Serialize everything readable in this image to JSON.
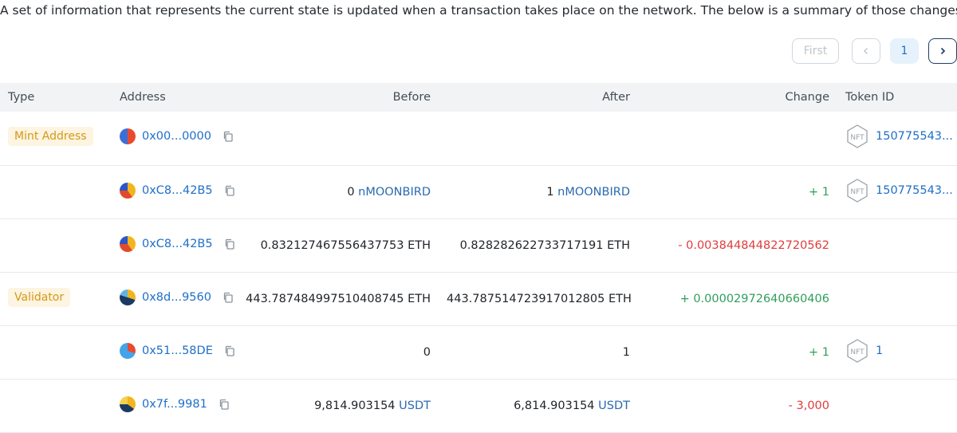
{
  "description": "A set of information that represents the current state is updated when a transaction takes place on the network. The below is a summary of those changes.",
  "pagination": {
    "first_label": "First",
    "current_page": "1"
  },
  "columns": [
    "Type",
    "Address",
    "Before",
    "After",
    "Change",
    "Token ID"
  ],
  "rows": [
    {
      "type": "Mint Address",
      "address": "0x00...0000",
      "before_amount": "",
      "before_token": "",
      "after_amount": "",
      "after_token": "",
      "change": "",
      "change_sign": "",
      "token_id": "150775543..."
    },
    {
      "type": "",
      "address": "0xC8...42B5",
      "before_amount": "0",
      "before_token": "nMOONBIRD",
      "after_amount": "1",
      "after_token": "nMOONBIRD",
      "change": "+ 1",
      "change_sign": "pos",
      "token_id": "150775543..."
    },
    {
      "type": "",
      "address": "0xC8...42B5",
      "before_amount": "0.832127467556437753 ETH",
      "before_token": "",
      "after_amount": "0.828282622733717191 ETH",
      "after_token": "",
      "change": "- 0.003844844822720562",
      "change_sign": "neg",
      "token_id": ""
    },
    {
      "type": "Validator",
      "address": "0x8d...9560",
      "before_amount": "443.787484997510408745 ETH",
      "before_token": "",
      "after_amount": "443.787514723917012805 ETH",
      "after_token": "",
      "change": "+ 0.00002972640660406",
      "change_sign": "pos",
      "token_id": ""
    },
    {
      "type": "",
      "address": "0x51...58DE",
      "before_amount": "0",
      "before_token": "",
      "after_amount": "1",
      "after_token": "",
      "change": "+ 1",
      "change_sign": "pos",
      "token_id": "1"
    },
    {
      "type": "",
      "address": "0x7f...9981",
      "before_amount": "9,814.903154",
      "before_token": "USDT",
      "after_amount": "6,814.903154",
      "after_token": "USDT",
      "change": "- 3,000",
      "change_sign": "neg",
      "token_id": ""
    }
  ],
  "colors": {
    "link": "#1f6fc7",
    "positive": "#2f9e5b",
    "negative": "#e03c3c",
    "badge_text": "#d39a16",
    "badge_bg": "#fdf4e1"
  },
  "icons": {
    "copy": "copy-icon",
    "nft": "nft-token-icon",
    "prev": "chevron-left-icon",
    "next": "chevron-right-icon"
  }
}
